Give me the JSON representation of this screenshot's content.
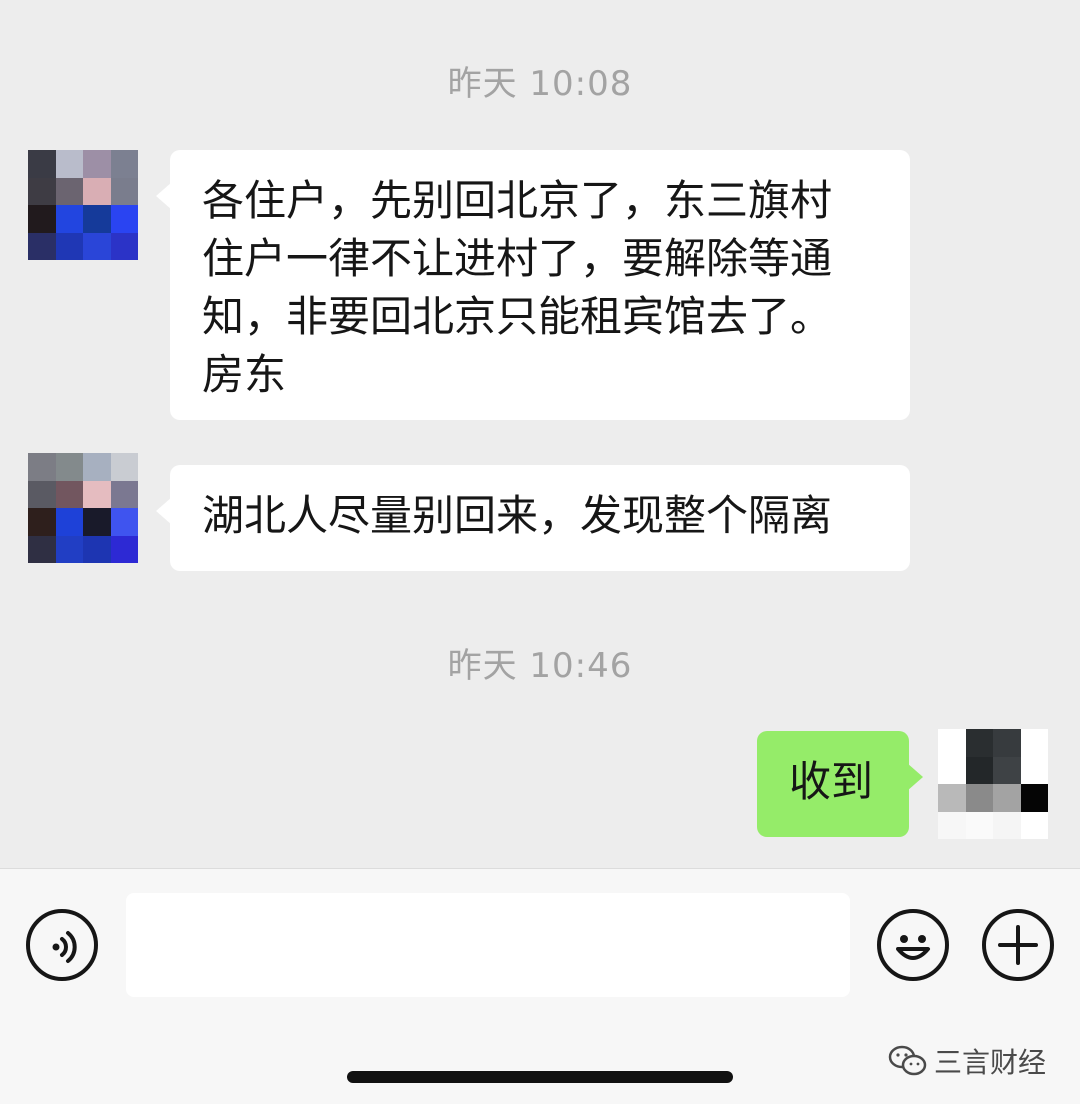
{
  "chat": {
    "timestamp_1": "昨天 10:08",
    "timestamp_2": "昨天 10:46",
    "messages": [
      {
        "from": "other",
        "lines": [
          "各住户，先别回北京了，东三旗村",
          "住户一律不让进村了，要解除等通",
          "知，非要回北京只能租宾馆去了。",
          "房东"
        ]
      },
      {
        "from": "other",
        "lines": [
          "湖北人尽量别回来，发现整个隔离"
        ]
      },
      {
        "from": "me",
        "lines": [
          "收到"
        ]
      }
    ]
  },
  "input_bar": {
    "voice_icon": "voice-icon",
    "emoji_icon": "emoji-icon",
    "plus_icon": "plus-icon",
    "text_value": ""
  },
  "watermark": {
    "text": "三言财经",
    "icon": "wechat-icon"
  },
  "colors": {
    "background": "#ededed",
    "incoming_bubble": "#ffffff",
    "outgoing_bubble": "#95ec69",
    "timestamp_text": "#a3a3a3"
  }
}
